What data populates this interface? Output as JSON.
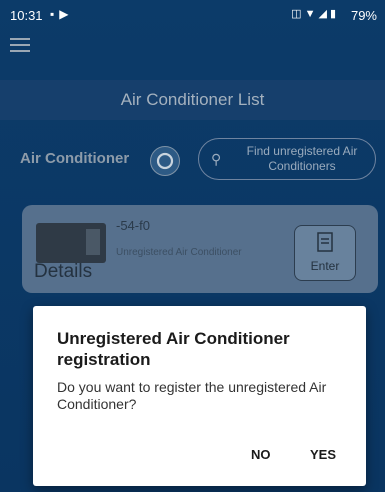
{
  "status_bar": {
    "time": "10:31",
    "battery": "79%",
    "left_icons": [
      "image-icon",
      "play-icon"
    ],
    "right_icons": [
      "vibrate-icon",
      "wifi-icon",
      "signal-icon",
      "battery-icon"
    ]
  },
  "header": {
    "title": "Air Conditioner List",
    "menu_icon": "hamburger-icon"
  },
  "toolbar": {
    "label": "Air Conditioner",
    "refresh_icon": "refresh-icon",
    "find_button_label": "Find unregistered Air Conditioners",
    "find_icon": "search-icon"
  },
  "device_card": {
    "name": "-54-f0",
    "status": "Unregistered Air Conditioner",
    "details_label": "Details",
    "enter_label": "Enter"
  },
  "dialog": {
    "title": "Unregistered Air Conditioner registration",
    "message": "Do you want to register the unregistered Air Conditioner?",
    "no_label": "NO",
    "yes_label": "YES"
  },
  "colors": {
    "background": "#0a3763",
    "title_bar": "#163f6c",
    "card": "#56708d",
    "dialog": "#ffffff"
  }
}
